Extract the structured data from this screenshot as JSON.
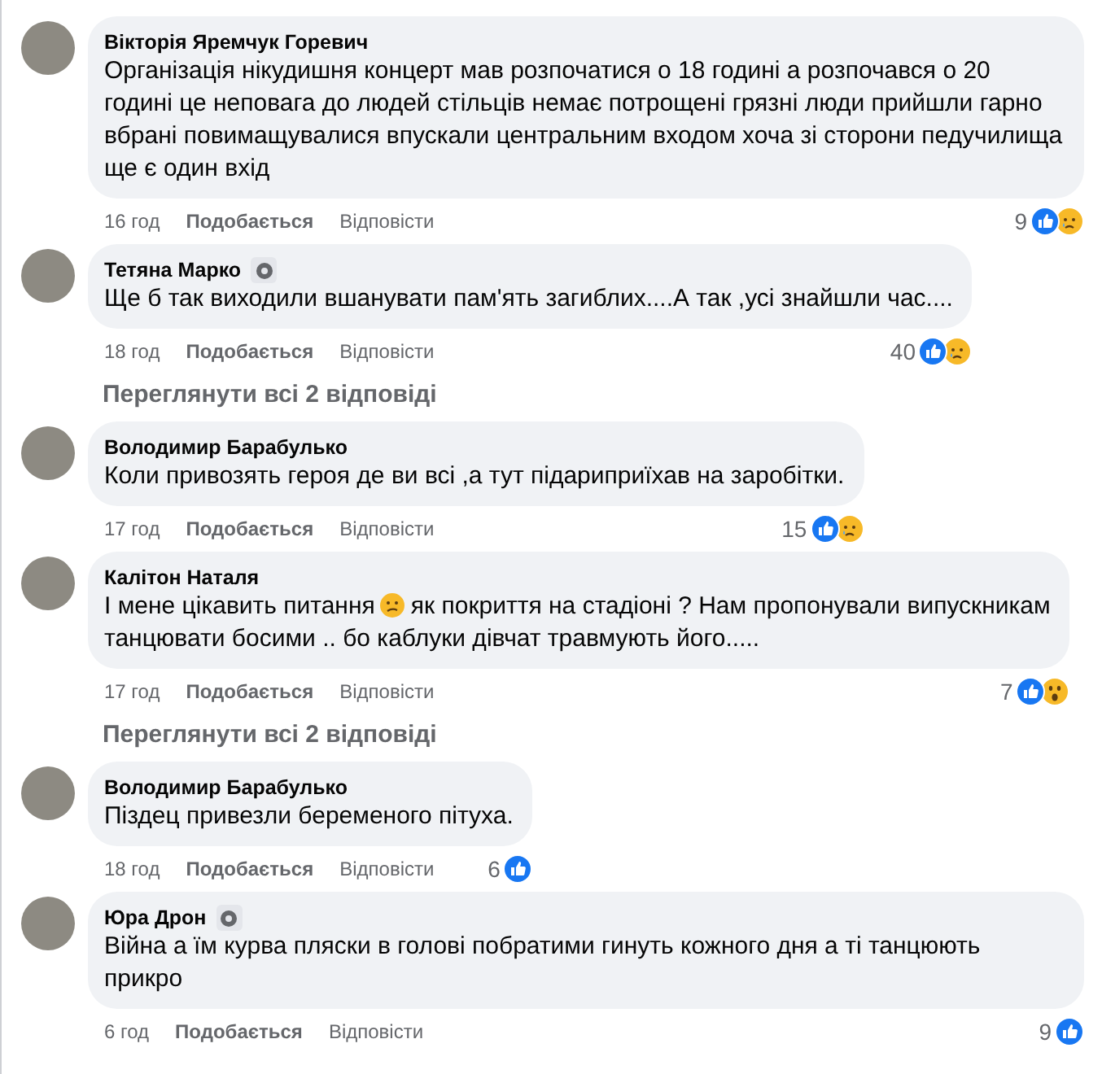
{
  "items": [
    {
      "kind": "comment",
      "author": "Вікторія Яремчук Горевич",
      "badge": false,
      "text": [
        {
          "kind": "text",
          "t": "Організація нікудишня концерт мав розпочатися о 18 годині а розпочався о 20 годині це неповага до людей стільців немає потрощені грязні люди прийшли гарно вбрані повимащувалися впускали центральним входом хоча зі сторони педучилища ще є один вхід"
        }
      ],
      "time": "16 год",
      "like": "Подобається",
      "reply": "Відповісти",
      "count": "9",
      "reactions": [
        {
          "kind": "like"
        },
        {
          "kind": "sad"
        }
      ]
    },
    {
      "kind": "comment",
      "author": "Тетяна Марко",
      "badge": true,
      "text": [
        {
          "kind": "text",
          "t": "Ще б так виходили вшанувати пам'ять загиблих....А так ,усі знайшли час...."
        }
      ],
      "time": "18 год",
      "like": "Подобається",
      "reply": "Відповісти",
      "count": "40",
      "reactions": [
        {
          "kind": "like"
        },
        {
          "kind": "sad"
        }
      ]
    },
    {
      "kind": "more",
      "label": "Переглянути всі 2 відповіді"
    },
    {
      "kind": "comment",
      "author": "Володимир Барабулько",
      "badge": false,
      "text": [
        {
          "kind": "text",
          "t": "Коли привозять героя де ви всі ,а тут підариприїхав на заробітки."
        }
      ],
      "time": "17 год",
      "like": "Подобається",
      "reply": "Відповісти",
      "count": "15",
      "reactions": [
        {
          "kind": "like"
        },
        {
          "kind": "sad"
        }
      ]
    },
    {
      "kind": "comment",
      "author": "Калітон Наталя",
      "badge": false,
      "text": [
        {
          "kind": "inline",
          "t": "І мене цікавить питання"
        },
        {
          "kind": "emoji"
        },
        {
          "kind": "inline",
          "t": "як покриття на стадіоні ? Нам пропонували випускникам"
        },
        {
          "kind": "text",
          "t": "танцювати босими .. бо каблуки дівчат травмують його....."
        }
      ],
      "time": "17 год",
      "like": "Подобається",
      "reply": "Відповісти",
      "count": "7",
      "reactions": [
        {
          "kind": "like"
        },
        {
          "kind": "wow"
        }
      ]
    },
    {
      "kind": "more",
      "label": "Переглянути всі 2 відповіді"
    },
    {
      "kind": "comment",
      "author": "Володимир Барабулько",
      "badge": false,
      "text": [
        {
          "kind": "text",
          "t": "Піздец привезли беременого пітуха."
        }
      ],
      "time": "18 год",
      "like": "Подобається",
      "reply": "Відповісти",
      "count": "6",
      "reactions": [
        {
          "kind": "like"
        }
      ]
    },
    {
      "kind": "comment",
      "author": "Юра Дрон",
      "badge": true,
      "text": [
        {
          "kind": "text",
          "t": "Війна а їм курва пляски в голові побратими гинуть кожного дня а ті танцюють прикро"
        }
      ],
      "time": "6 год",
      "like": "Подобається",
      "reply": "Відповісти",
      "count": "9",
      "reactions": [
        {
          "kind": "like"
        }
      ]
    }
  ]
}
